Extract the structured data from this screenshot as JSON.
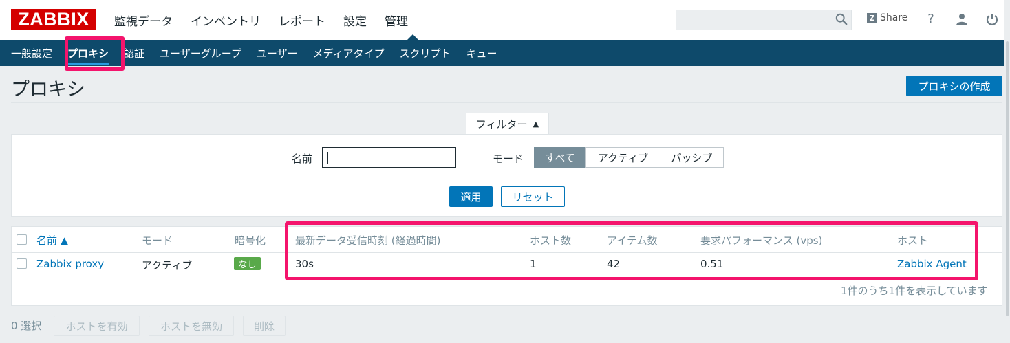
{
  "header": {
    "logo": "ZABBIX",
    "nav": [
      "監視データ",
      "インベントリ",
      "レポート",
      "設定",
      "管理"
    ],
    "active_nav": "管理",
    "search_placeholder": "",
    "share_label": "Share"
  },
  "subnav": {
    "items": [
      "一般設定",
      "プロキシ",
      "認証",
      "ユーザーグループ",
      "ユーザー",
      "メディアタイプ",
      "スクリプト",
      "キュー"
    ],
    "selected": "プロキシ"
  },
  "page": {
    "title": "プロキシ",
    "create_button": "プロキシの作成"
  },
  "filter": {
    "tab_label": "フィルター",
    "name_label": "名前",
    "name_value": "",
    "mode_label": "モード",
    "mode_options": [
      "すべて",
      "アクティブ",
      "パッシブ"
    ],
    "mode_selected": "すべて",
    "apply_label": "適用",
    "reset_label": "リセット"
  },
  "table": {
    "headers": [
      "名前 ▲",
      "モード",
      "暗号化",
      "最新データ受信時刻 (経過時間)",
      "ホスト数",
      "アイテム数",
      "要求パフォーマンス (vps)",
      "ホスト"
    ],
    "rows": [
      {
        "name": "Zabbix proxy",
        "mode": "アクティブ",
        "encryption": "なし",
        "last_seen": "30s",
        "host_count": "1",
        "item_count": "42",
        "vps": "0.51",
        "hosts": "Zabbix Agent"
      }
    ],
    "summary": "1件のうち1件を表示しています"
  },
  "footer": {
    "selected_count": "0 選択",
    "actions": [
      "ホストを有効",
      "ホストを無効",
      "削除"
    ]
  },
  "colors": {
    "brand_red": "#d40000",
    "subnav_bg": "#0e4a6b",
    "primary_blue": "#0275b8",
    "badge_green": "#59a94a",
    "highlight": "#f4146c"
  }
}
